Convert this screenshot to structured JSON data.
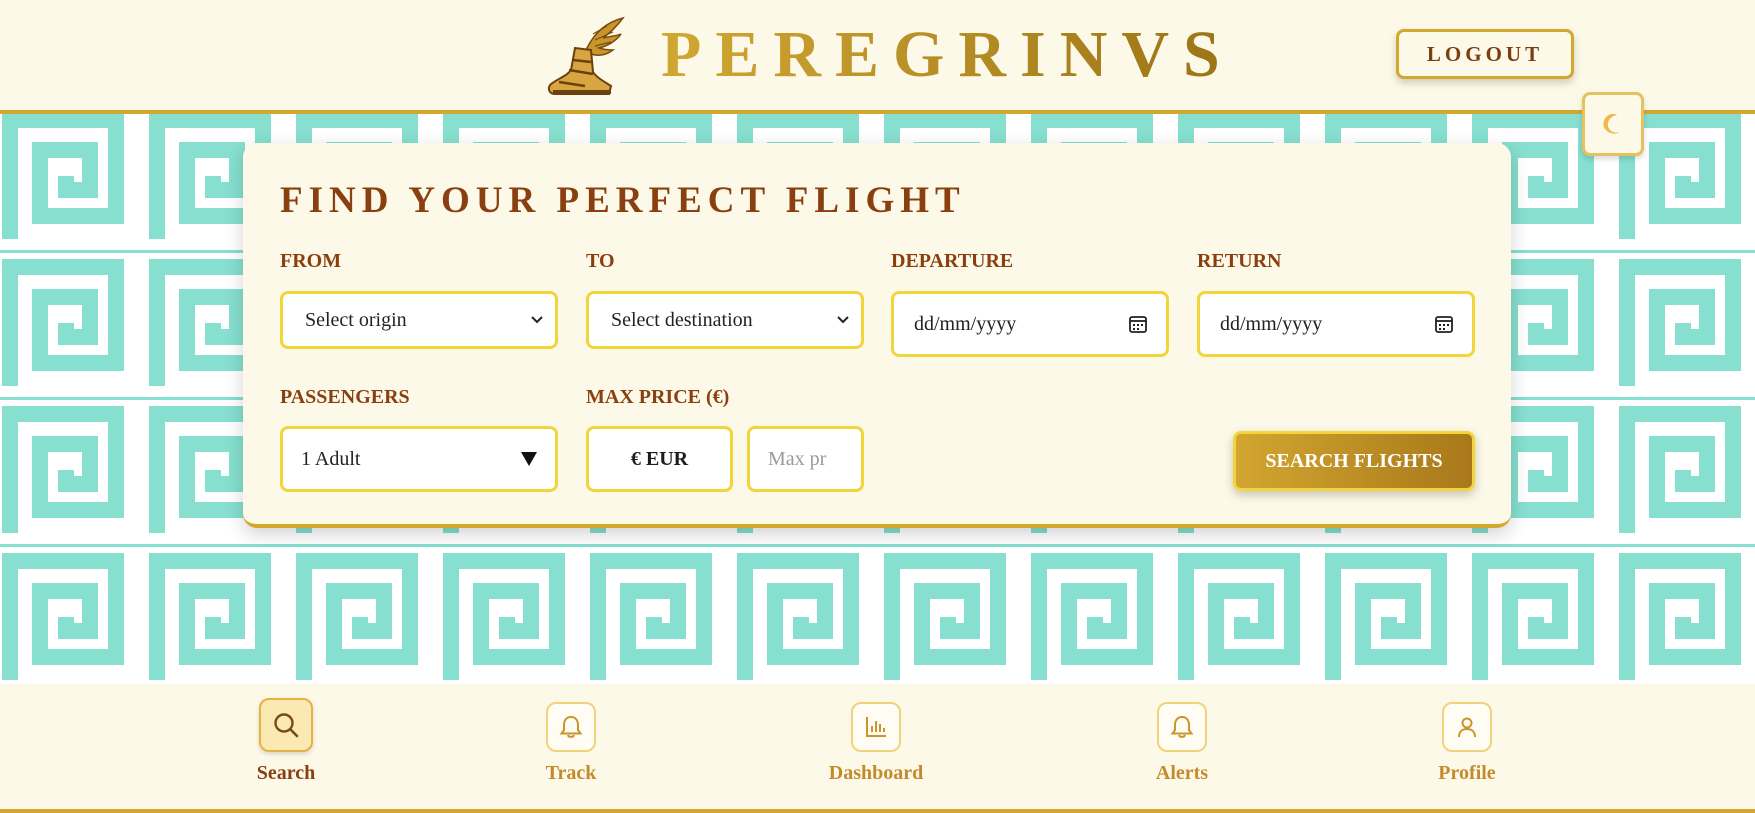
{
  "app": {
    "brand": "PEREGRINVS",
    "logout_label": "LOGOUT",
    "theme_icon": "moon-icon"
  },
  "search": {
    "title": "FIND YOUR PERFECT FLIGHT",
    "from": {
      "label": "FROM",
      "value": "Select origin"
    },
    "to": {
      "label": "TO",
      "value": "Select destination"
    },
    "departure": {
      "label": "DEPARTURE",
      "value": "dd/mm/yyyy"
    },
    "return": {
      "label": "RETURN",
      "value": "dd/mm/yyyy"
    },
    "passengers": {
      "label": "PASSENGERS",
      "value": "1 Adult"
    },
    "max_price": {
      "label": "MAX PRICE (€)",
      "currency": "€ EUR",
      "placeholder": "Max pr"
    },
    "submit_label": "SEARCH FLIGHTS"
  },
  "nav": {
    "items": [
      {
        "label": "Search",
        "icon": "search-icon",
        "active": true
      },
      {
        "label": "Track",
        "icon": "bell-icon",
        "active": false
      },
      {
        "label": "Dashboard",
        "icon": "bar-chart-icon",
        "active": false
      },
      {
        "label": "Alerts",
        "icon": "bell-icon",
        "active": false
      },
      {
        "label": "Profile",
        "icon": "user-icon",
        "active": false
      }
    ]
  },
  "colors": {
    "gold": "#d4a82e",
    "brown": "#8a3f10",
    "cream": "#fdf9e8",
    "teal": "#86dfcf",
    "field_border": "#f2d53b"
  }
}
